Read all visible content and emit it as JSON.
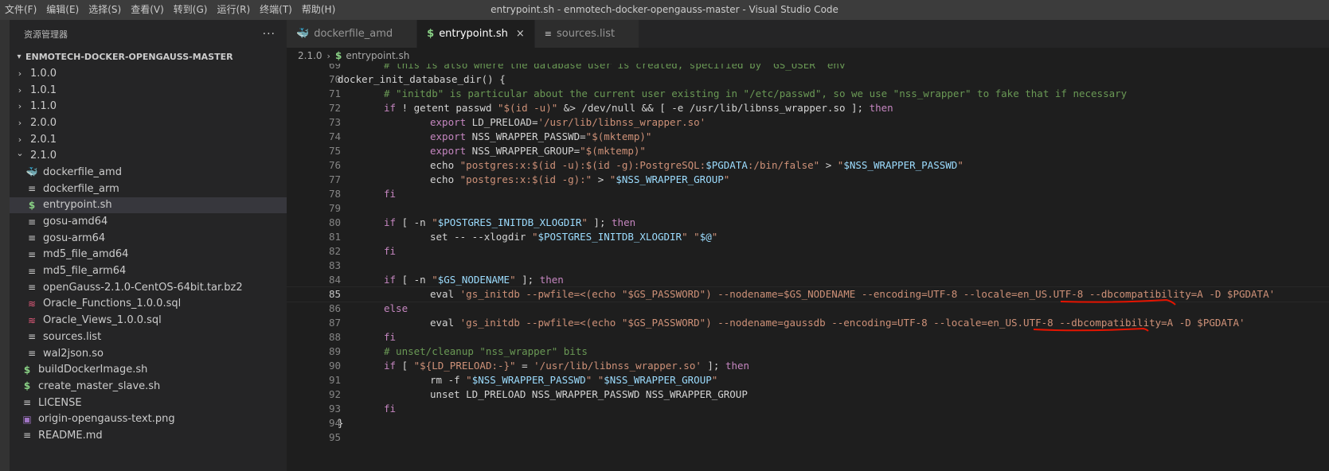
{
  "window": {
    "title": "entrypoint.sh - enmotech-docker-opengauss-master - Visual Studio Code"
  },
  "menu": [
    "文件(F)",
    "编辑(E)",
    "选择(S)",
    "查看(V)",
    "转到(G)",
    "运行(R)",
    "终端(T)",
    "帮助(H)"
  ],
  "sidebar": {
    "title": "资源管理器",
    "more": "···",
    "root": "ENMOTECH-DOCKER-OPENGAUSS-MASTER",
    "items": [
      {
        "label": "1.0.0",
        "type": "folder",
        "open": false,
        "depth": 1
      },
      {
        "label": "1.0.1",
        "type": "folder",
        "open": false,
        "depth": 1
      },
      {
        "label": "1.1.0",
        "type": "folder",
        "open": false,
        "depth": 1
      },
      {
        "label": "2.0.0",
        "type": "folder",
        "open": false,
        "depth": 1
      },
      {
        "label": "2.0.1",
        "type": "folder",
        "open": false,
        "depth": 1
      },
      {
        "label": "2.1.0",
        "type": "folder",
        "open": true,
        "depth": 1
      },
      {
        "label": "dockerfile_amd",
        "type": "docker",
        "depth": 2
      },
      {
        "label": "dockerfile_arm",
        "type": "lines",
        "depth": 2
      },
      {
        "label": "entrypoint.sh",
        "type": "dollar",
        "depth": 2,
        "selected": true
      },
      {
        "label": "gosu-amd64",
        "type": "lines",
        "depth": 2
      },
      {
        "label": "gosu-arm64",
        "type": "lines",
        "depth": 2
      },
      {
        "label": "md5_file_amd64",
        "type": "lines",
        "depth": 2
      },
      {
        "label": "md5_file_arm64",
        "type": "lines",
        "depth": 2
      },
      {
        "label": "openGauss-2.1.0-CentOS-64bit.tar.bz2",
        "type": "lines",
        "depth": 2
      },
      {
        "label": "Oracle_Functions_1.0.0.sql",
        "type": "db",
        "depth": 2
      },
      {
        "label": "Oracle_Views_1.0.0.sql",
        "type": "db",
        "depth": 2
      },
      {
        "label": "sources.list",
        "type": "lines",
        "depth": 2
      },
      {
        "label": "wal2json.so",
        "type": "lines",
        "depth": 2
      },
      {
        "label": "buildDockerImage.sh",
        "type": "dollar",
        "depth": 1
      },
      {
        "label": "create_master_slave.sh",
        "type": "dollar",
        "depth": 1
      },
      {
        "label": "LICENSE",
        "type": "lines",
        "depth": 1
      },
      {
        "label": "origin-opengauss-text.png",
        "type": "image",
        "depth": 1
      },
      {
        "label": "README.md",
        "type": "lines",
        "depth": 1
      }
    ]
  },
  "tabs": [
    {
      "label": "dockerfile_amd",
      "icon": "docker-icon",
      "active": false
    },
    {
      "label": "entrypoint.sh",
      "icon": "dollar-icon",
      "active": true,
      "close": "×"
    },
    {
      "label": "sources.list",
      "icon": "lines-icon",
      "active": false
    }
  ],
  "breadcrumb": {
    "folder": "2.1.0",
    "sep": "›",
    "file": "entrypoint.sh"
  },
  "editor": {
    "current_line": 85,
    "lines": [
      {
        "n": "69",
        "ind": 1,
        "toks": [
          [
            "cmt",
            "# this is also where the database user is created, specified by `GS_USER` env"
          ]
        ]
      },
      {
        "n": "70",
        "ind": 0,
        "toks": [
          [
            "def",
            "docker_init_database_dir() {"
          ]
        ]
      },
      {
        "n": "71",
        "ind": 1,
        "toks": [
          [
            "cmt",
            "# \"initdb\" is particular about the current user existing in \"/etc/passwd\", so we use \"nss_wrapper\" to fake that if necessary"
          ]
        ]
      },
      {
        "n": "72",
        "ind": 1,
        "toks": [
          [
            "kw",
            "if"
          ],
          [
            "def",
            " ! getent passwd "
          ],
          [
            "str",
            "\"$(id -u)\""
          ],
          [
            "def",
            " &> /dev/null && [ -e /usr/lib/libnss_wrapper.so ]; "
          ],
          [
            "kw",
            "then"
          ]
        ]
      },
      {
        "n": "73",
        "ind": 2,
        "toks": [
          [
            "kw",
            "export"
          ],
          [
            "def",
            " LD_PRELOAD="
          ],
          [
            "str",
            "'/usr/lib/libnss_wrapper.so'"
          ]
        ]
      },
      {
        "n": "74",
        "ind": 2,
        "toks": [
          [
            "kw",
            "export"
          ],
          [
            "def",
            " NSS_WRAPPER_PASSWD="
          ],
          [
            "str",
            "\"$(mktemp)\""
          ]
        ]
      },
      {
        "n": "75",
        "ind": 2,
        "toks": [
          [
            "kw",
            "export"
          ],
          [
            "def",
            " NSS_WRAPPER_GROUP="
          ],
          [
            "str",
            "\"$(mktemp)\""
          ]
        ]
      },
      {
        "n": "76",
        "ind": 2,
        "toks": [
          [
            "def",
            "echo "
          ],
          [
            "str",
            "\"postgres:x:$(id -u):$(id -g):PostgreSQL:"
          ],
          [
            "var",
            "$PGDATA"
          ],
          [
            "str",
            ":/bin/false\""
          ],
          [
            "def",
            " > "
          ],
          [
            "str",
            "\""
          ],
          [
            "var",
            "$NSS_WRAPPER_PASSWD"
          ],
          [
            "str",
            "\""
          ]
        ]
      },
      {
        "n": "77",
        "ind": 2,
        "toks": [
          [
            "def",
            "echo "
          ],
          [
            "str",
            "\"postgres:x:$(id -g):\""
          ],
          [
            "def",
            " > "
          ],
          [
            "str",
            "\""
          ],
          [
            "var",
            "$NSS_WRAPPER_GROUP"
          ],
          [
            "str",
            "\""
          ]
        ]
      },
      {
        "n": "78",
        "ind": 1,
        "toks": [
          [
            "kw",
            "fi"
          ]
        ]
      },
      {
        "n": "79",
        "ind": 0,
        "toks": []
      },
      {
        "n": "80",
        "ind": 1,
        "toks": [
          [
            "kw",
            "if"
          ],
          [
            "def",
            " [ -n "
          ],
          [
            "str",
            "\""
          ],
          [
            "var",
            "$POSTGRES_INITDB_XLOGDIR"
          ],
          [
            "str",
            "\""
          ],
          [
            "def",
            " ]; "
          ],
          [
            "kw",
            "then"
          ]
        ]
      },
      {
        "n": "81",
        "ind": 2,
        "toks": [
          [
            "def",
            "set -- --xlogdir "
          ],
          [
            "str",
            "\""
          ],
          [
            "var",
            "$POSTGRES_INITDB_XLOGDIR"
          ],
          [
            "str",
            "\""
          ],
          [
            "def",
            " "
          ],
          [
            "str",
            "\""
          ],
          [
            "var",
            "$@"
          ],
          [
            "str",
            "\""
          ]
        ]
      },
      {
        "n": "82",
        "ind": 1,
        "toks": [
          [
            "kw",
            "fi"
          ]
        ]
      },
      {
        "n": "83",
        "ind": 0,
        "toks": []
      },
      {
        "n": "84",
        "ind": 1,
        "toks": [
          [
            "kw",
            "if"
          ],
          [
            "def",
            " [ -n "
          ],
          [
            "str",
            "\""
          ],
          [
            "var",
            "$GS_NODENAME"
          ],
          [
            "str",
            "\""
          ],
          [
            "def",
            " ]; "
          ],
          [
            "kw",
            "then"
          ]
        ]
      },
      {
        "n": "85",
        "ind": 2,
        "toks": [
          [
            "def",
            "eval "
          ],
          [
            "str",
            "'gs_initdb --pwfile=<(echo \"$GS_PASSWORD\") --nodename=$GS_NODENAME --encoding=UTF-8 --locale=en_US.UTF-8 --dbcompatibility=A -D $PGDATA'"
          ]
        ]
      },
      {
        "n": "86",
        "ind": 1,
        "toks": [
          [
            "kw",
            "else"
          ]
        ]
      },
      {
        "n": "87",
        "ind": 2,
        "toks": [
          [
            "def",
            "eval "
          ],
          [
            "str",
            "'gs_initdb --pwfile=<(echo \"$GS_PASSWORD\") --nodename=gaussdb --encoding=UTF-8 --locale=en_US.UTF-8 --dbcompatibility=A -D $PGDATA'"
          ]
        ]
      },
      {
        "n": "88",
        "ind": 1,
        "toks": [
          [
            "kw",
            "fi"
          ]
        ]
      },
      {
        "n": "89",
        "ind": 1,
        "toks": [
          [
            "cmt",
            "# unset/cleanup \"nss_wrapper\" bits"
          ]
        ]
      },
      {
        "n": "90",
        "ind": 1,
        "toks": [
          [
            "kw",
            "if"
          ],
          [
            "def",
            " [ "
          ],
          [
            "str",
            "\"${LD_PRELOAD:-}\""
          ],
          [
            "def",
            " = "
          ],
          [
            "str",
            "'/usr/lib/libnss_wrapper.so'"
          ],
          [
            "def",
            " ]; "
          ],
          [
            "kw",
            "then"
          ]
        ]
      },
      {
        "n": "91",
        "ind": 2,
        "toks": [
          [
            "def",
            "rm -f "
          ],
          [
            "str",
            "\""
          ],
          [
            "var",
            "$NSS_WRAPPER_PASSWD"
          ],
          [
            "str",
            "\""
          ],
          [
            "def",
            " "
          ],
          [
            "str",
            "\""
          ],
          [
            "var",
            "$NSS_WRAPPER_GROUP"
          ],
          [
            "str",
            "\""
          ]
        ]
      },
      {
        "n": "92",
        "ind": 2,
        "toks": [
          [
            "def",
            "unset LD_PRELOAD NSS_WRAPPER_PASSWD NSS_WRAPPER_GROUP"
          ]
        ]
      },
      {
        "n": "93",
        "ind": 1,
        "toks": [
          [
            "kw",
            "fi"
          ]
        ]
      },
      {
        "n": "94",
        "ind": 0,
        "toks": [
          [
            "def",
            "}"
          ]
        ]
      },
      {
        "n": "95",
        "ind": 0,
        "toks": []
      }
    ]
  },
  "annotations": {
    "underline_color": "#e51400"
  }
}
